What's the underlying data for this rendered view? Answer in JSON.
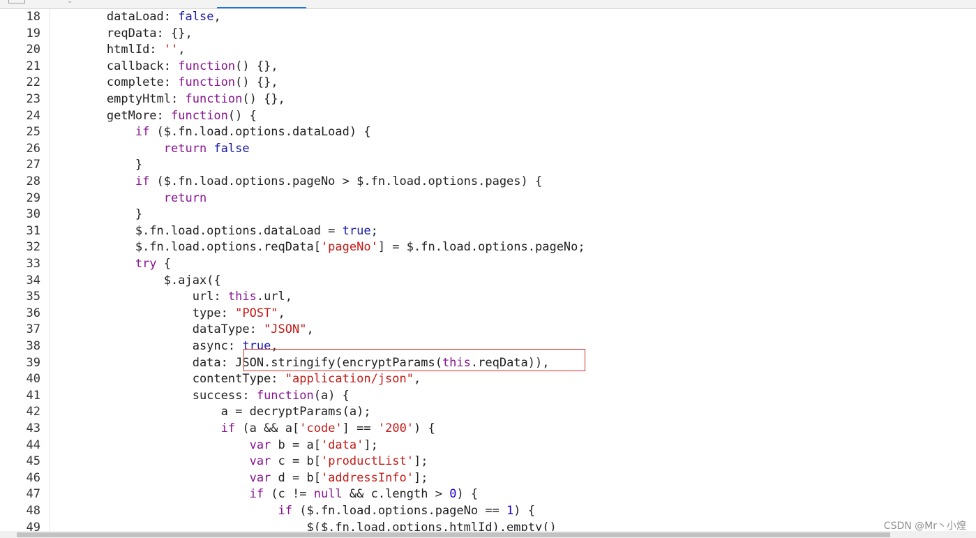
{
  "editor": {
    "lines": [
      {
        "num": "18",
        "indent": "        ",
        "tokens": [
          {
            "t": "dataLoad: ",
            "c": "key"
          },
          {
            "t": "false",
            "c": "kwb"
          },
          {
            "t": ",",
            "c": "key"
          }
        ]
      },
      {
        "num": "19",
        "indent": "        ",
        "tokens": [
          {
            "t": "reqData: {},",
            "c": "key"
          }
        ]
      },
      {
        "num": "20",
        "indent": "        ",
        "tokens": [
          {
            "t": "htmlId: ",
            "c": "key"
          },
          {
            "t": "''",
            "c": "str"
          },
          {
            "t": ",",
            "c": "key"
          }
        ]
      },
      {
        "num": "21",
        "indent": "        ",
        "tokens": [
          {
            "t": "callback: ",
            "c": "key"
          },
          {
            "t": "function",
            "c": "kw"
          },
          {
            "t": "() {},",
            "c": "key"
          }
        ]
      },
      {
        "num": "22",
        "indent": "        ",
        "tokens": [
          {
            "t": "complete: ",
            "c": "key"
          },
          {
            "t": "function",
            "c": "kw"
          },
          {
            "t": "() {},",
            "c": "key"
          }
        ]
      },
      {
        "num": "23",
        "indent": "        ",
        "tokens": [
          {
            "t": "emptyHtml: ",
            "c": "key"
          },
          {
            "t": "function",
            "c": "kw"
          },
          {
            "t": "() {},",
            "c": "key"
          }
        ]
      },
      {
        "num": "24",
        "indent": "        ",
        "tokens": [
          {
            "t": "getMore: ",
            "c": "key"
          },
          {
            "t": "function",
            "c": "kw"
          },
          {
            "t": "() {",
            "c": "key"
          }
        ]
      },
      {
        "num": "25",
        "indent": "            ",
        "tokens": [
          {
            "t": "if",
            "c": "kw"
          },
          {
            "t": " ($.fn.load.options.dataLoad) {",
            "c": "key"
          }
        ]
      },
      {
        "num": "26",
        "indent": "                ",
        "tokens": [
          {
            "t": "return",
            "c": "kw"
          },
          {
            "t": " ",
            "c": "key"
          },
          {
            "t": "false",
            "c": "kwb"
          }
        ]
      },
      {
        "num": "27",
        "indent": "            ",
        "tokens": [
          {
            "t": "}",
            "c": "key"
          }
        ]
      },
      {
        "num": "28",
        "indent": "            ",
        "tokens": [
          {
            "t": "if",
            "c": "kw"
          },
          {
            "t": " ($.fn.load.options.pageNo > $.fn.load.options.pages) {",
            "c": "key"
          }
        ]
      },
      {
        "num": "29",
        "indent": "                ",
        "tokens": [
          {
            "t": "return",
            "c": "kw"
          }
        ]
      },
      {
        "num": "30",
        "indent": "            ",
        "tokens": [
          {
            "t": "}",
            "c": "key"
          }
        ]
      },
      {
        "num": "31",
        "indent": "            ",
        "tokens": [
          {
            "t": "$.fn.load.options.dataLoad = ",
            "c": "key"
          },
          {
            "t": "true",
            "c": "kwb"
          },
          {
            "t": ";",
            "c": "key"
          }
        ]
      },
      {
        "num": "32",
        "indent": "            ",
        "tokens": [
          {
            "t": "$.fn.load.options.reqData[",
            "c": "key"
          },
          {
            "t": "'pageNo'",
            "c": "str"
          },
          {
            "t": "] = $.fn.load.options.pageNo;",
            "c": "key"
          }
        ]
      },
      {
        "num": "33",
        "indent": "            ",
        "tokens": [
          {
            "t": "try",
            "c": "kw"
          },
          {
            "t": " {",
            "c": "key"
          }
        ]
      },
      {
        "num": "34",
        "indent": "                ",
        "tokens": [
          {
            "t": "$.ajax({",
            "c": "key"
          }
        ]
      },
      {
        "num": "35",
        "indent": "                    ",
        "tokens": [
          {
            "t": "url: ",
            "c": "key"
          },
          {
            "t": "this",
            "c": "kw"
          },
          {
            "t": ".url,",
            "c": "key"
          }
        ]
      },
      {
        "num": "36",
        "indent": "                    ",
        "tokens": [
          {
            "t": "type: ",
            "c": "key"
          },
          {
            "t": "\"POST\"",
            "c": "str"
          },
          {
            "t": ",",
            "c": "key"
          }
        ]
      },
      {
        "num": "37",
        "indent": "                    ",
        "tokens": [
          {
            "t": "dataType: ",
            "c": "key"
          },
          {
            "t": "\"JSON\"",
            "c": "str"
          },
          {
            "t": ",",
            "c": "key"
          }
        ]
      },
      {
        "num": "38",
        "indent": "                    ",
        "tokens": [
          {
            "t": "async: ",
            "c": "key"
          },
          {
            "t": "true",
            "c": "kwb"
          },
          {
            "t": ",",
            "c": "key"
          }
        ]
      },
      {
        "num": "39",
        "indent": "                    ",
        "tokens": [
          {
            "t": "data: JSON.stringify(encryptParams(",
            "c": "key"
          },
          {
            "t": "this",
            "c": "kw"
          },
          {
            "t": ".reqData)),",
            "c": "key"
          }
        ]
      },
      {
        "num": "40",
        "indent": "                    ",
        "tokens": [
          {
            "t": "contentType: ",
            "c": "key"
          },
          {
            "t": "\"application/json\"",
            "c": "str"
          },
          {
            "t": ",",
            "c": "key"
          }
        ]
      },
      {
        "num": "41",
        "indent": "                    ",
        "tokens": [
          {
            "t": "success: ",
            "c": "key"
          },
          {
            "t": "function",
            "c": "kw"
          },
          {
            "t": "(a) {",
            "c": "key"
          }
        ]
      },
      {
        "num": "42",
        "indent": "                        ",
        "tokens": [
          {
            "t": "a = decryptParams(a);",
            "c": "key"
          }
        ]
      },
      {
        "num": "43",
        "indent": "                        ",
        "tokens": [
          {
            "t": "if",
            "c": "kw"
          },
          {
            "t": " (a && a[",
            "c": "key"
          },
          {
            "t": "'code'",
            "c": "str"
          },
          {
            "t": "] == ",
            "c": "key"
          },
          {
            "t": "'200'",
            "c": "str"
          },
          {
            "t": ") {",
            "c": "key"
          }
        ]
      },
      {
        "num": "44",
        "indent": "                            ",
        "tokens": [
          {
            "t": "var",
            "c": "kw"
          },
          {
            "t": " b = a[",
            "c": "key"
          },
          {
            "t": "'data'",
            "c": "str"
          },
          {
            "t": "];",
            "c": "key"
          }
        ]
      },
      {
        "num": "45",
        "indent": "                            ",
        "tokens": [
          {
            "t": "var",
            "c": "kw"
          },
          {
            "t": " c = b[",
            "c": "key"
          },
          {
            "t": "'productList'",
            "c": "str"
          },
          {
            "t": "];",
            "c": "key"
          }
        ]
      },
      {
        "num": "46",
        "indent": "                            ",
        "tokens": [
          {
            "t": "var",
            "c": "kw"
          },
          {
            "t": " d = b[",
            "c": "key"
          },
          {
            "t": "'addressInfo'",
            "c": "str"
          },
          {
            "t": "];",
            "c": "key"
          }
        ]
      },
      {
        "num": "47",
        "indent": "                            ",
        "tokens": [
          {
            "t": "if",
            "c": "kw"
          },
          {
            "t": " (c != ",
            "c": "key"
          },
          {
            "t": "null",
            "c": "kw"
          },
          {
            "t": " && c.length > ",
            "c": "key"
          },
          {
            "t": "0",
            "c": "num"
          },
          {
            "t": ") {",
            "c": "key"
          }
        ]
      },
      {
        "num": "48",
        "indent": "                                ",
        "tokens": [
          {
            "t": "if",
            "c": "kw"
          },
          {
            "t": " ($.fn.load.options.pageNo == ",
            "c": "key"
          },
          {
            "t": "1",
            "c": "num"
          },
          {
            "t": ") {",
            "c": "key"
          }
        ]
      },
      {
        "num": "49",
        "indent": "                                    ",
        "tokens": [
          {
            "t": "$($.fn.load.options.htmlId).empty()",
            "c": "key"
          }
        ]
      }
    ]
  },
  "watermark": "CSDN @Mr丶小煌",
  "colors": {
    "keyword": "#881391",
    "literal": "#1a1aa6",
    "string": "#c41a16",
    "number": "#1c00cf",
    "highlight_border": "#d62b2b",
    "active_tab": "#1a73e8"
  }
}
